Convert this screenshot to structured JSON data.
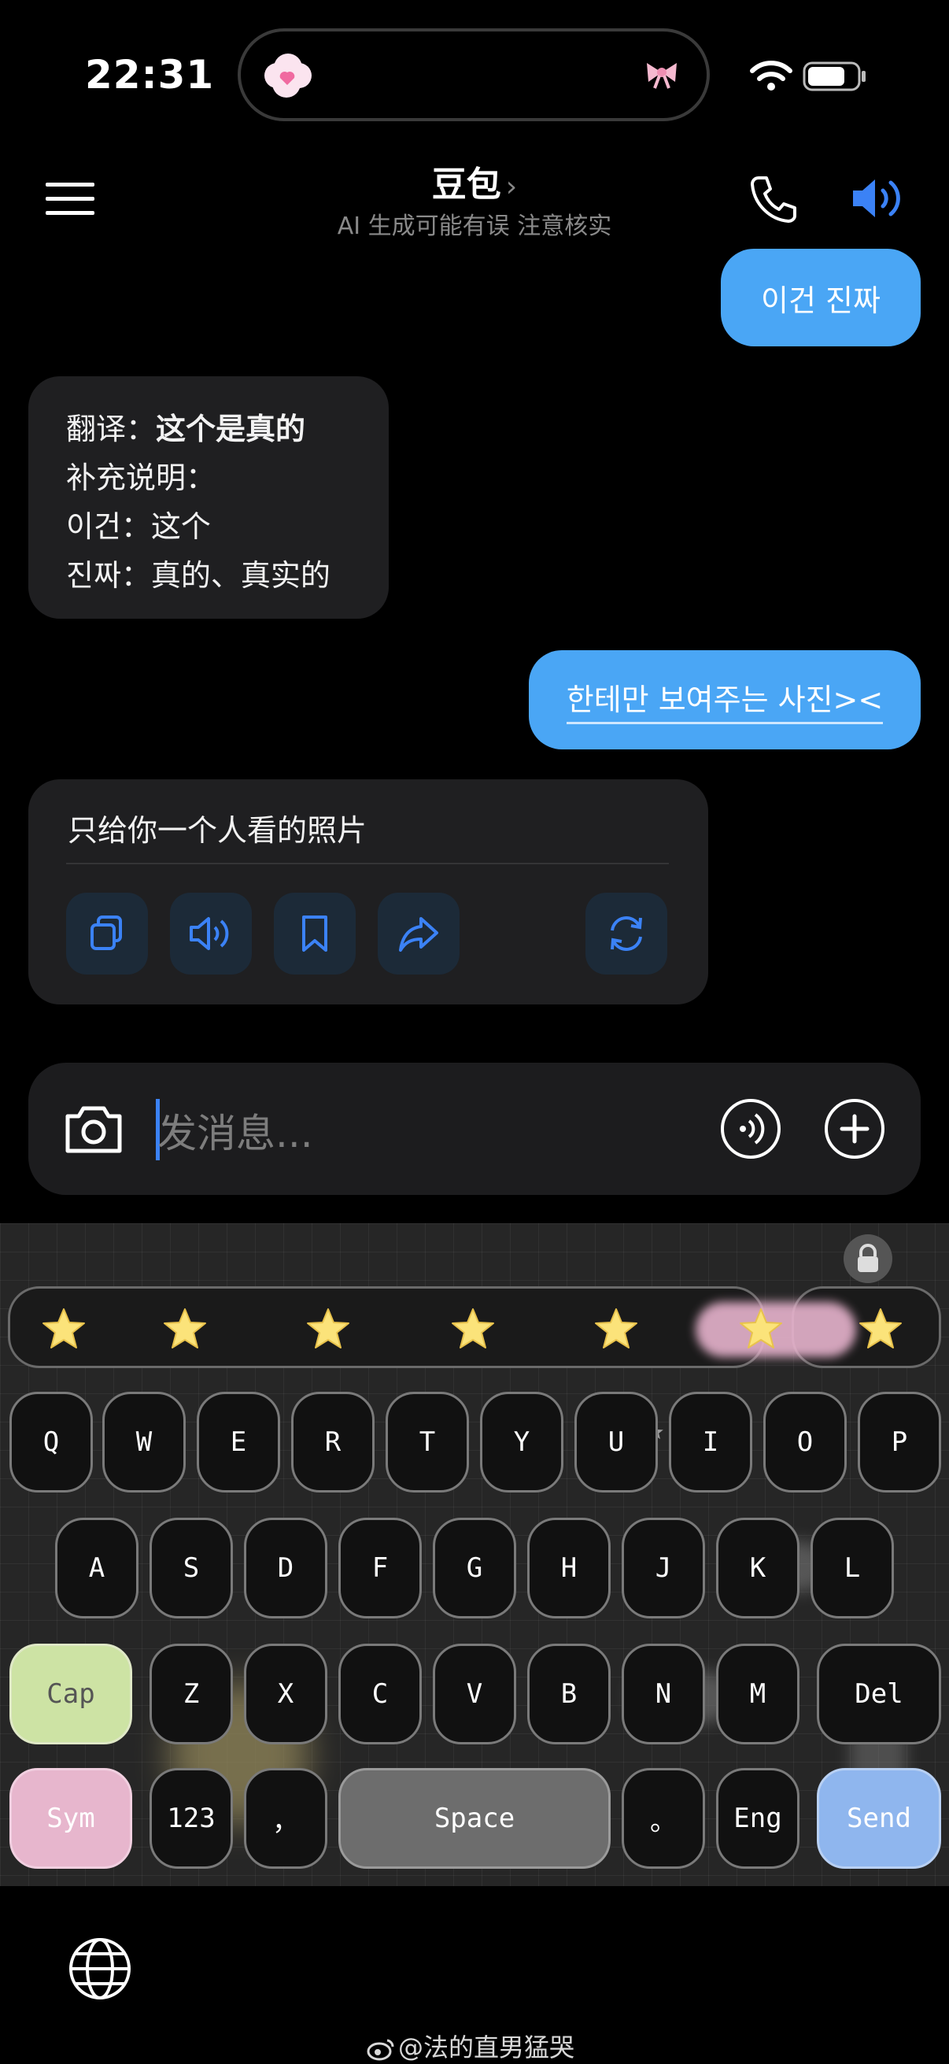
{
  "status_bar": {
    "time": "22:31"
  },
  "header": {
    "title": "豆包",
    "title_chevron": "›",
    "subtitle": "AI 生成可能有误 注意核实"
  },
  "messages": [
    {
      "role": "user",
      "text": "이건 진짜"
    },
    {
      "role": "assistant",
      "lines": [
        {
          "label": "翻译：",
          "value": "这个是真的",
          "bold": true
        },
        {
          "label": "补充说明："
        },
        {
          "label": "이건：",
          "value": "这个"
        },
        {
          "label": "진짜：",
          "value": "真的、真实的"
        }
      ]
    },
    {
      "role": "user",
      "text": "한테만 보여주는 사진><"
    },
    {
      "role": "assistant",
      "text": "只给你一个人看的照片",
      "actions": [
        "copy-icon",
        "read-aloud-icon",
        "bookmark-icon",
        "share-icon",
        "regenerate-icon"
      ]
    }
  ],
  "input": {
    "placeholder": "发消息..."
  },
  "keyboard": {
    "rows": [
      [
        "Q",
        "W",
        "E",
        "R",
        "T",
        "Y",
        "U",
        "I",
        "O",
        "P"
      ],
      [
        "A",
        "S",
        "D",
        "F",
        "G",
        "H",
        "J",
        "K",
        "L"
      ],
      [
        "Cap",
        "Z",
        "X",
        "C",
        "V",
        "B",
        "N",
        "M",
        "Del"
      ],
      [
        "Sym",
        "123",
        "，",
        "Space",
        "。",
        "Eng",
        "Send"
      ]
    ]
  },
  "watermark": "@法的直男猛哭",
  "colors": {
    "user_bubble": "#4aa6f5",
    "accent": "#3b82f6",
    "cap_key": "#cde3a4",
    "sym_key": "#e7b6cd",
    "send_key": "#8fb6ee"
  }
}
